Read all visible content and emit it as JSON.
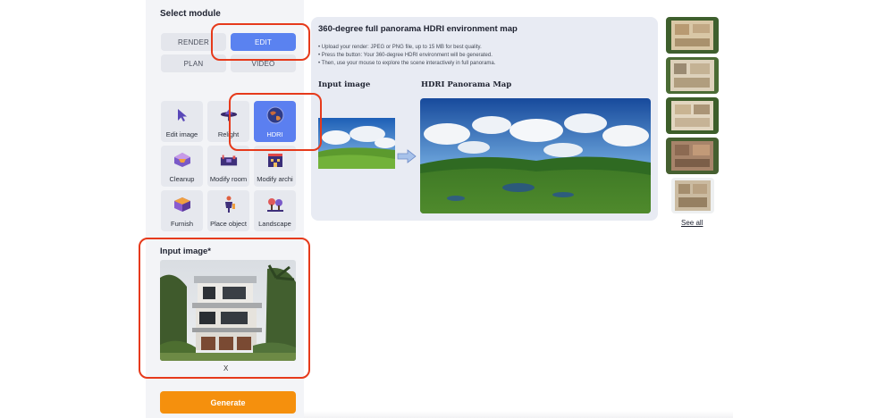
{
  "module": {
    "title": "Select module",
    "modes": [
      "RENDER",
      "EDIT",
      "PLAN",
      "VIDEO"
    ],
    "active_mode": "EDIT"
  },
  "tools": [
    {
      "label": "Edit image",
      "icon": "cursor-arrow-icon"
    },
    {
      "label": "Relight",
      "icon": "lamp-icon"
    },
    {
      "label": "HDRI",
      "icon": "globe-icon",
      "active": true
    },
    {
      "label": "Cleanup",
      "icon": "cleanup-icon"
    },
    {
      "label": "Modify room",
      "icon": "room-icon"
    },
    {
      "label": "Modify archi",
      "icon": "building-icon"
    },
    {
      "label": "Furnish",
      "icon": "cube-furniture-icon"
    },
    {
      "label": "Place object",
      "icon": "object-figure-icon"
    },
    {
      "label": "Landscape",
      "icon": "tree-icon"
    }
  ],
  "input": {
    "title": "Input image*",
    "remove_label": "X"
  },
  "generate_label": "Generate",
  "info": {
    "title": "360-degree full panorama HDRI environment map",
    "bullets": [
      "• Upload your render: JPEG or PNG file, up to 15 MB for best quality.",
      "• Press the button: Your 360-degree HDRI environment will be generated.",
      "• Then, use your mouse to explore the scene interactively in full panorama."
    ],
    "input_heading": "Input image",
    "output_heading": "HDRI Panorama Map"
  },
  "gallery": {
    "see_all": "See all"
  },
  "colors": {
    "accent": "#5a82f0",
    "annotation": "#e63a1b",
    "generate": "#f5900d"
  }
}
